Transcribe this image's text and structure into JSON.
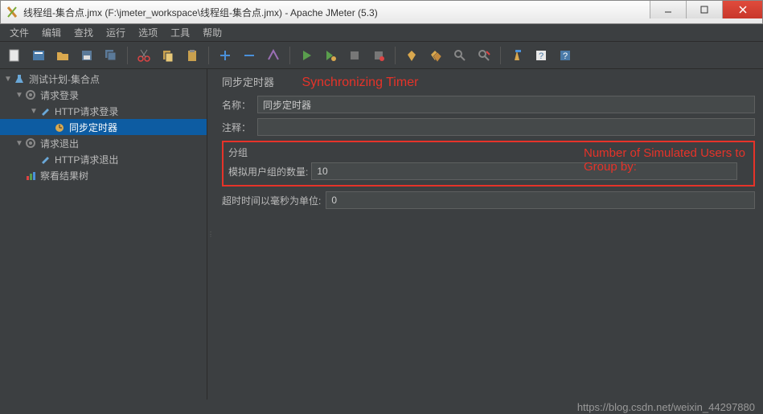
{
  "window": {
    "title": "线程组-集合点.jmx (F:\\jmeter_workspace\\线程组-集合点.jmx) - Apache JMeter (5.3)"
  },
  "menu": {
    "file": "文件",
    "edit": "编辑",
    "search": "查找",
    "run": "运行",
    "options": "选项",
    "tools": "工具",
    "help": "帮助"
  },
  "tree": {
    "test_plan": "测试计划-集合点",
    "request_login": "请求登录",
    "http_login": "HTTP请求登录",
    "sync_timer": "同步定时器",
    "request_logout": "请求退出",
    "http_logout": "HTTP请求退出",
    "view_results": "察看结果树"
  },
  "panel": {
    "title": "同步定时器",
    "anno_title": "Synchronizing Timer",
    "name_label": "名称：",
    "name_value": "同步定时器",
    "comment_label": "注释：",
    "comment_value": "",
    "group_label": "分组",
    "sim_users_label": "模拟用户组的数量:",
    "sim_users_value": "10",
    "anno_users": "Number of Simulated Users to Group by:",
    "timeout_label": "超时时间以毫秒为单位:",
    "timeout_value": "0"
  },
  "footer": {
    "url": "https://blog.csdn.net/weixin_44297880"
  }
}
